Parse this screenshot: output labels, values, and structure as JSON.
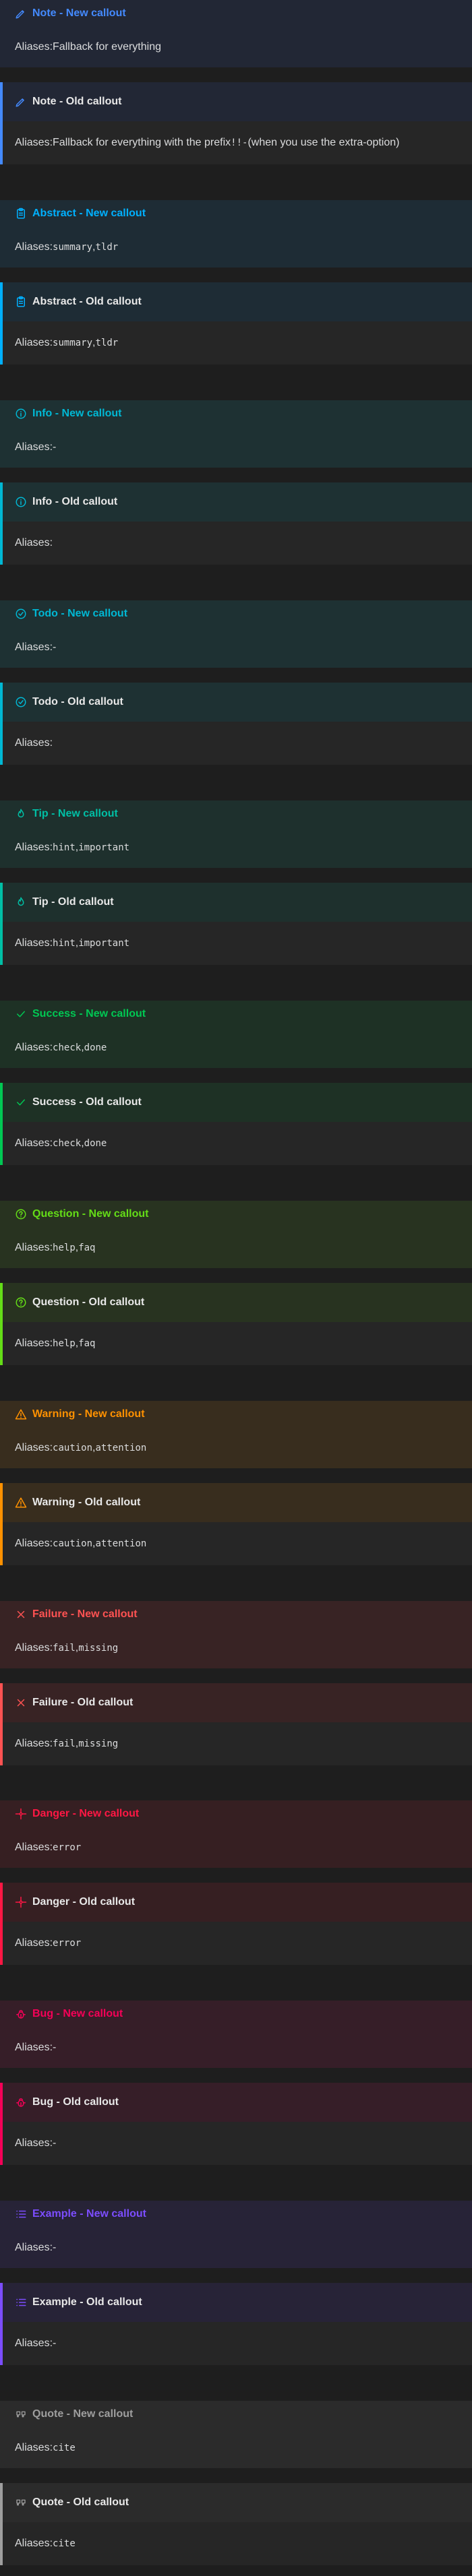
{
  "callouts": [
    {
      "key": "note",
      "color": "#448aff",
      "bg": "#222735",
      "icon": "pencil-icon",
      "new_title": "Note - New callout",
      "old_title": "Note - Old callout",
      "new_body": {
        "prefix": "Aliases: ",
        "text": "Fallback for everything"
      },
      "old_body": {
        "prefix": "Aliases: ",
        "text": "Fallback for everything with the prefix",
        "code": "!!-",
        "suffix": " (when you use the extra-option)"
      }
    },
    {
      "key": "abstract",
      "color": "#00b0ff",
      "bg": "#1e2c35",
      "icon": "clipboard-icon",
      "new_title": "Abstract - New callout",
      "old_title": "Abstract - Old callout",
      "aliases": [
        "summary",
        "tldr"
      ]
    },
    {
      "key": "info",
      "color": "#00b8d4",
      "bg": "#1e3133",
      "icon": "info-icon",
      "new_title": "Info - New callout",
      "old_title": "Info - Old callout",
      "new_body_text": "-",
      "old_body_text": ""
    },
    {
      "key": "todo",
      "color": "#00b8d4",
      "bg": "#1e3133",
      "icon": "check-circle-icon",
      "new_title": "Todo - New callout",
      "old_title": "Todo - Old callout",
      "new_body_text": "-",
      "old_body_text": ""
    },
    {
      "key": "tip",
      "color": "#00bfa5",
      "bg": "#1e302d",
      "icon": "flame-icon",
      "new_title": "Tip - New callout",
      "old_title": "Tip - Old callout",
      "aliases": [
        "hint",
        "important"
      ]
    },
    {
      "key": "success",
      "color": "#00c853",
      "bg": "#1e3125",
      "icon": "check-icon",
      "new_title": "Success - New callout",
      "old_title": "Success - Old callout",
      "aliases": [
        "check",
        "done"
      ]
    },
    {
      "key": "question",
      "color": "#64dd17",
      "bg": "#283320",
      "icon": "help-circle-icon",
      "new_title": "Question - New callout",
      "old_title": "Question - Old callout",
      "aliases": [
        "help",
        "faq"
      ]
    },
    {
      "key": "warning",
      "color": "#ff9100",
      "bg": "#382d1e",
      "icon": "alert-triangle-icon",
      "new_title": "Warning - New callout",
      "old_title": "Warning - Old callout",
      "aliases": [
        "caution",
        "attention"
      ]
    },
    {
      "key": "failure",
      "color": "#ff5252",
      "bg": "#382324",
      "icon": "x-icon",
      "new_title": "Failure - New callout",
      "old_title": "Failure - Old callout",
      "aliases": [
        "fail",
        "missing"
      ]
    },
    {
      "key": "danger",
      "color": "#ff1744",
      "bg": "#361f22",
      "icon": "zap-icon",
      "new_title": "Danger - New callout",
      "old_title": "Danger - Old callout",
      "aliases": [
        "error"
      ]
    },
    {
      "key": "bug",
      "color": "#f50057",
      "bg": "#361e28",
      "icon": "bug-icon",
      "new_title": "Bug - New callout",
      "old_title": "Bug - Old callout",
      "new_body_text": "-",
      "old_body_text": "-",
      "old_prefix": "Aliases: "
    },
    {
      "key": "example",
      "color": "#7c4dff",
      "bg": "#272337",
      "icon": "list-icon",
      "new_title": "Example - New callout",
      "old_title": "Example - Old callout",
      "new_body_text": "-",
      "old_body_text": "-",
      "old_prefix": "Aliases: "
    },
    {
      "key": "quote",
      "color": "#9e9e9e",
      "bg": "#2b2b2b",
      "icon": "quote-icon",
      "new_title": "Quote - New callout",
      "old_title": "Quote - Old callout",
      "aliases": [
        "cite"
      ]
    }
  ]
}
